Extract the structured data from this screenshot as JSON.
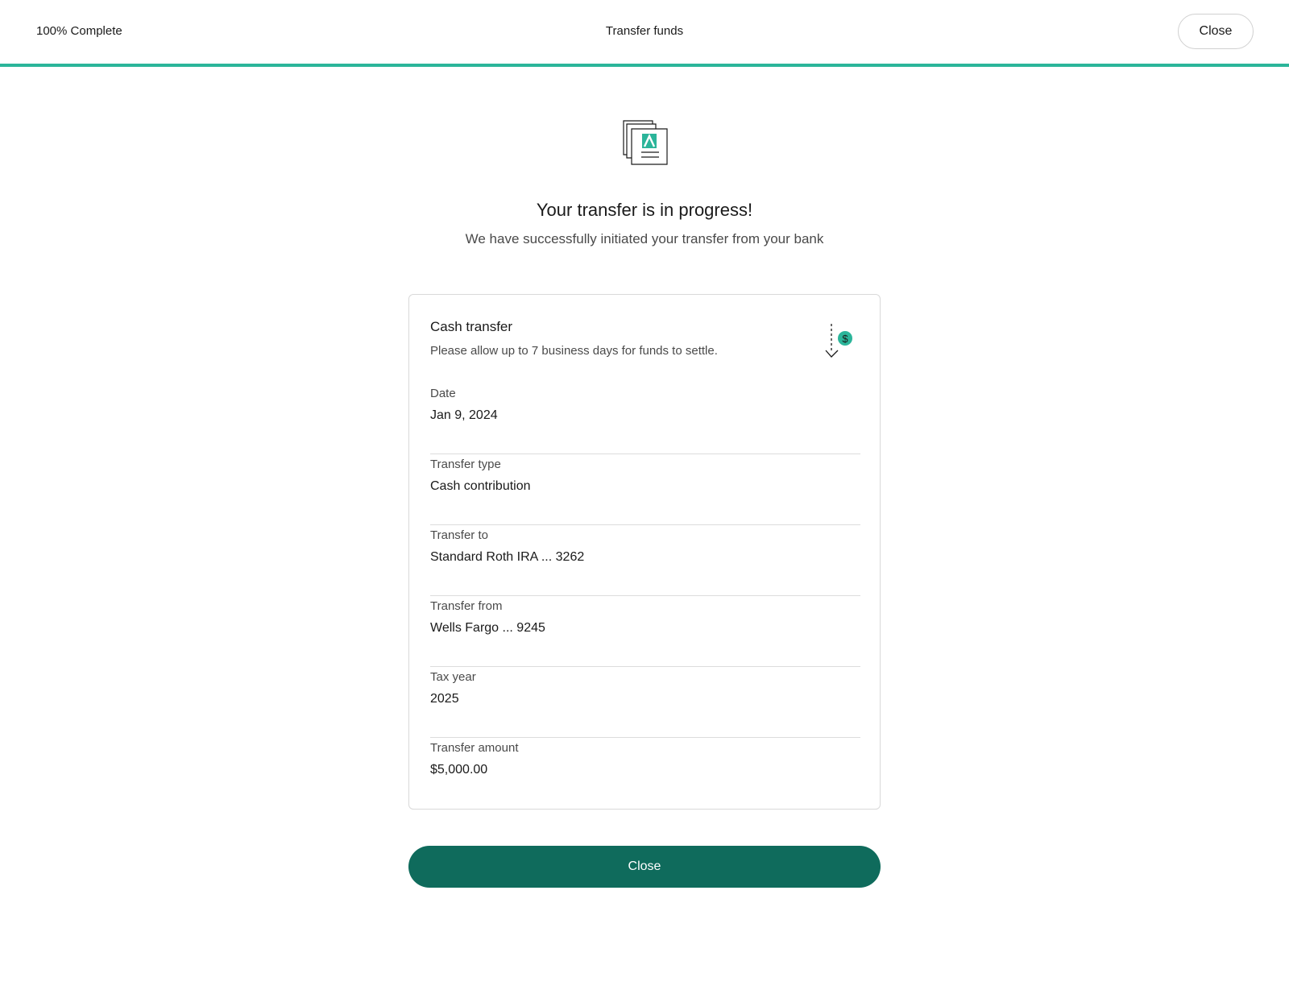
{
  "header": {
    "progress_text": "100% Complete",
    "progress_fraction": 1.0,
    "title": "Transfer funds",
    "close_label": "Close"
  },
  "colors": {
    "accent": "#2bb59a",
    "primary_button": "#0f6b5c"
  },
  "hero": {
    "icon": "documents-icon",
    "headline": "Your transfer is in progress!",
    "subhead": "We have successfully initiated your transfer from your bank"
  },
  "card": {
    "title": "Cash transfer",
    "subtitle": "Please allow up to 7 business days for funds to settle.",
    "icon": "cash-transfer-icon",
    "rows": [
      {
        "label": "Date",
        "value": "Jan 9, 2024"
      },
      {
        "label": "Transfer type",
        "value": "Cash contribution"
      },
      {
        "label": "Transfer to",
        "value": "Standard Roth IRA ... 3262"
      },
      {
        "label": "Transfer from",
        "value": "Wells Fargo ... 9245"
      },
      {
        "label": "Tax year",
        "value": "2025"
      },
      {
        "label": "Transfer amount",
        "value": "$5,000.00"
      }
    ]
  },
  "footer": {
    "close_label": "Close"
  }
}
